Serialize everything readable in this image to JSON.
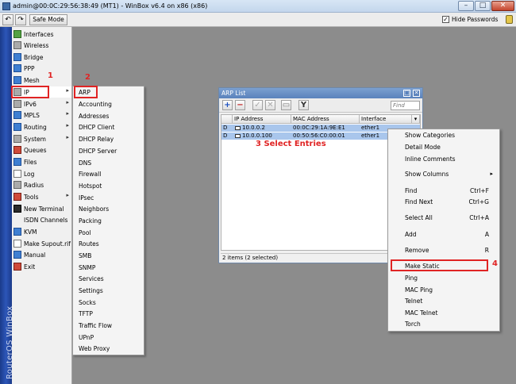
{
  "window": {
    "title": "admin@00:0C:29:56:38:49 (MT1) - WinBox v6.4 on x86 (x86)",
    "minimize": "–",
    "maximize": "□",
    "close": "✕"
  },
  "toolbar": {
    "undo": "↶",
    "redo": "↷",
    "safe_mode": "Safe Mode",
    "hide_passwords": "Hide Passwords",
    "hide_passwords_checked": "✓"
  },
  "brand": "RouterOS WinBox",
  "sidebar": {
    "items": [
      {
        "label": "Interfaces",
        "icon": "interfaces-icon"
      },
      {
        "label": "Wireless",
        "icon": "wireless-icon"
      },
      {
        "label": "Bridge",
        "icon": "bridge-icon"
      },
      {
        "label": "PPP",
        "icon": "ppp-icon"
      },
      {
        "label": "Mesh",
        "icon": "mesh-icon"
      },
      {
        "label": "IP",
        "icon": "ip-icon",
        "submenu": true
      },
      {
        "label": "IPv6",
        "icon": "ipv6-icon",
        "submenu": true
      },
      {
        "label": "MPLS",
        "icon": "mpls-icon",
        "submenu": true
      },
      {
        "label": "Routing",
        "icon": "routing-icon",
        "submenu": true
      },
      {
        "label": "System",
        "icon": "system-icon",
        "submenu": true
      },
      {
        "label": "Queues",
        "icon": "queues-icon"
      },
      {
        "label": "Files",
        "icon": "files-icon"
      },
      {
        "label": "Log",
        "icon": "log-icon"
      },
      {
        "label": "Radius",
        "icon": "radius-icon"
      },
      {
        "label": "Tools",
        "icon": "tools-icon",
        "submenu": true
      },
      {
        "label": "New Terminal",
        "icon": "terminal-icon"
      },
      {
        "label": "ISDN Channels",
        "icon": "isdn-icon"
      },
      {
        "label": "KVM",
        "icon": "kvm-icon"
      },
      {
        "label": "Make Supout.rif",
        "icon": "supout-icon"
      },
      {
        "label": "Manual",
        "icon": "manual-icon"
      },
      {
        "label": "Exit",
        "icon": "exit-icon"
      }
    ],
    "submenu_arrow": "▸"
  },
  "ip_submenu": {
    "items": [
      "ARP",
      "Accounting",
      "Addresses",
      "DHCP Client",
      "DHCP Relay",
      "DHCP Server",
      "DNS",
      "Firewall",
      "Hotspot",
      "IPsec",
      "Neighbors",
      "Packing",
      "Pool",
      "Routes",
      "SMB",
      "SNMP",
      "Services",
      "Settings",
      "Socks",
      "TFTP",
      "Traffic Flow",
      "UPnP",
      "Web Proxy"
    ]
  },
  "annotations": {
    "step1": "1",
    "step2": "2",
    "step3": "3 Select Entries",
    "step4": "4"
  },
  "arp_window": {
    "title": "ARP List",
    "title_buttons": [
      "□",
      "✕"
    ],
    "toolbar": {
      "add": "+",
      "remove": "−",
      "enable": "✓",
      "disable": "✕",
      "comment": "▭",
      "filter": "Y"
    },
    "find_placeholder": "Find",
    "columns": [
      "IP Address",
      "MAC Address",
      "Interface"
    ],
    "column_menu": "▾",
    "rows": [
      {
        "flag": "D",
        "ip": "10.0.0.2",
        "mac": "00:0C:29:1A:9E:E1",
        "interface": "ether1"
      },
      {
        "flag": "D",
        "ip": "10.0.0.100",
        "mac": "00:50:56:C0:00:01",
        "interface": "ether1"
      }
    ],
    "status": "2 items (2 selected)"
  },
  "context_menu": {
    "items": [
      {
        "label": "Show Categories",
        "shortcut": ""
      },
      {
        "label": "Detail Mode",
        "shortcut": ""
      },
      {
        "label": "Inline Comments",
        "shortcut": ""
      },
      {
        "label": "Show Columns",
        "shortcut": "",
        "submenu": "▸"
      },
      {
        "label": "Find",
        "shortcut": "Ctrl+F"
      },
      {
        "label": "Find Next",
        "shortcut": "Ctrl+G"
      },
      {
        "label": "Select All",
        "shortcut": "Ctrl+A"
      },
      {
        "label": "Add",
        "shortcut": "A"
      },
      {
        "label": "Remove",
        "shortcut": "R"
      },
      {
        "label": "Make Static",
        "shortcut": ""
      },
      {
        "label": "Ping",
        "shortcut": ""
      },
      {
        "label": "MAC Ping",
        "shortcut": ""
      },
      {
        "label": "Telnet",
        "shortcut": ""
      },
      {
        "label": "MAC Telnet",
        "shortcut": ""
      },
      {
        "label": "Torch",
        "shortcut": ""
      }
    ]
  },
  "colors": {
    "annotation_red": "#e02424",
    "selection_blue": "#a9c6ec",
    "brand_blue": "#2c56b8"
  }
}
